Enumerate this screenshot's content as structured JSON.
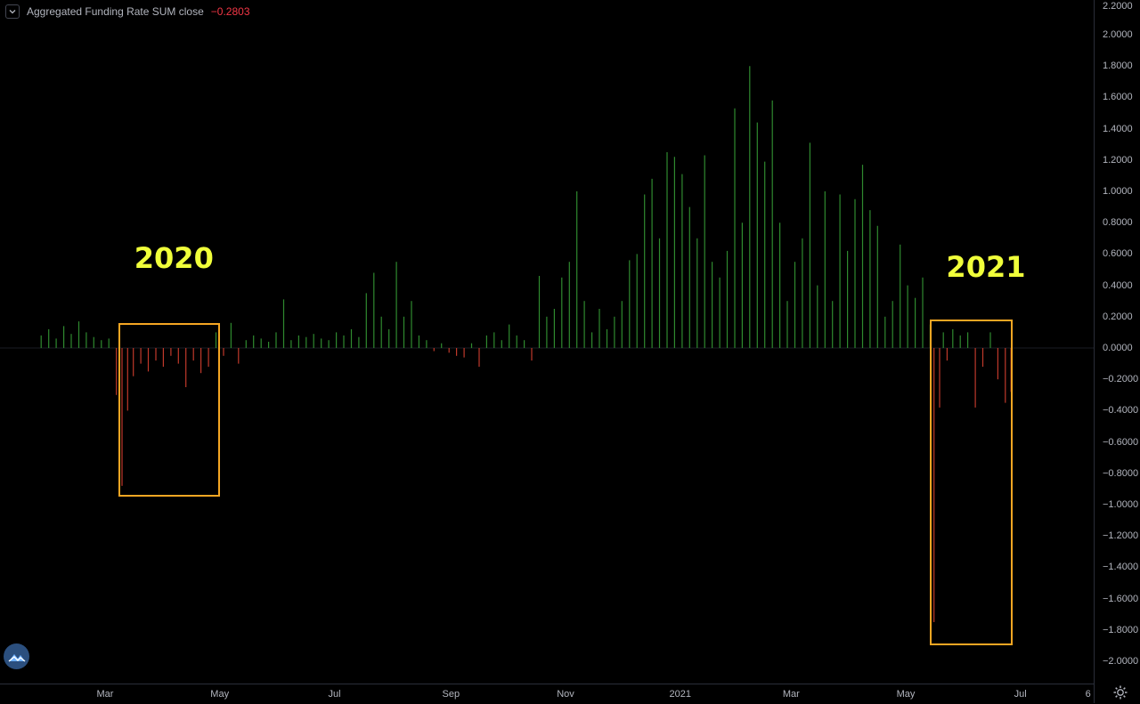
{
  "legend": {
    "title": "Aggregated Funding Rate SUM close",
    "value": "−0.2803",
    "value_color": "#f23645"
  },
  "annotations": [
    {
      "label": "2020",
      "from": "2020-03-08",
      "to": "2020-05-01",
      "top": 0.16,
      "bottom": -0.95
    },
    {
      "label": "2021",
      "from": "2021-05-14",
      "to": "2021-06-27",
      "top": 0.18,
      "bottom": -1.9
    }
  ],
  "colors": {
    "positive": "#2f8a2f",
    "negative": "#c0392b",
    "annotation_box": "#f5a623",
    "annotation_text": "#f0ff3a"
  },
  "icons": {
    "logo": "logo-icon",
    "settings": "gear-icon",
    "toggle": "chevron-down-icon"
  },
  "chart_data": {
    "type": "bar",
    "title": "Aggregated Funding Rate SUM close",
    "xlabel": "",
    "ylabel": "",
    "ylim": [
      -2.2,
      2.2
    ],
    "grid": false,
    "y_ticks": [
      "2.2000",
      "2.0000",
      "1.8000",
      "1.6000",
      "1.4000",
      "1.2000",
      "1.0000",
      "0.8000",
      "0.6000",
      "0.4000",
      "0.2000",
      "0.0000",
      "−0.2000",
      "−0.4000",
      "−0.6000",
      "−0.8000",
      "−1.0000",
      "−1.2000",
      "−1.4000",
      "−1.6000",
      "−1.8000",
      "−2.0000"
    ],
    "x_ticks": [
      {
        "label": "Mar",
        "date": "2020-03-01"
      },
      {
        "label": "May",
        "date": "2020-05-01"
      },
      {
        "label": "Jul",
        "date": "2020-07-01"
      },
      {
        "label": "Sep",
        "date": "2020-09-01"
      },
      {
        "label": "Nov",
        "date": "2020-11-01"
      },
      {
        "label": "2021",
        "date": "2021-01-01"
      },
      {
        "label": "Mar",
        "date": "2021-03-01"
      },
      {
        "label": "May",
        "date": "2021-05-01"
      },
      {
        "label": "Jul",
        "date": "2021-07-01"
      },
      {
        "label": "6",
        "date": "2021-08-06"
      }
    ],
    "x": [
      "2020-01-27",
      "2020-01-31",
      "2020-02-04",
      "2020-02-08",
      "2020-02-12",
      "2020-02-16",
      "2020-02-20",
      "2020-02-24",
      "2020-02-28",
      "2020-03-03",
      "2020-03-07",
      "2020-03-10",
      "2020-03-13",
      "2020-03-16",
      "2020-03-20",
      "2020-03-24",
      "2020-03-28",
      "2020-04-01",
      "2020-04-05",
      "2020-04-09",
      "2020-04-13",
      "2020-04-17",
      "2020-04-21",
      "2020-04-25",
      "2020-04-29",
      "2020-05-03",
      "2020-05-07",
      "2020-05-11",
      "2020-05-15",
      "2020-05-19",
      "2020-05-23",
      "2020-05-27",
      "2020-05-31",
      "2020-06-04",
      "2020-06-08",
      "2020-06-12",
      "2020-06-16",
      "2020-06-20",
      "2020-06-24",
      "2020-06-28",
      "2020-07-02",
      "2020-07-06",
      "2020-07-10",
      "2020-07-14",
      "2020-07-18",
      "2020-07-22",
      "2020-07-26",
      "2020-07-30",
      "2020-08-03",
      "2020-08-07",
      "2020-08-11",
      "2020-08-15",
      "2020-08-19",
      "2020-08-23",
      "2020-08-27",
      "2020-08-31",
      "2020-09-04",
      "2020-09-08",
      "2020-09-12",
      "2020-09-16",
      "2020-09-20",
      "2020-09-24",
      "2020-09-28",
      "2020-10-02",
      "2020-10-06",
      "2020-10-10",
      "2020-10-14",
      "2020-10-18",
      "2020-10-22",
      "2020-10-26",
      "2020-10-30",
      "2020-11-03",
      "2020-11-07",
      "2020-11-11",
      "2020-11-15",
      "2020-11-19",
      "2020-11-23",
      "2020-11-27",
      "2020-12-01",
      "2020-12-05",
      "2020-12-09",
      "2020-12-13",
      "2020-12-17",
      "2020-12-21",
      "2020-12-25",
      "2020-12-29",
      "2021-01-02",
      "2021-01-06",
      "2021-01-10",
      "2021-01-14",
      "2021-01-18",
      "2021-01-22",
      "2021-01-26",
      "2021-01-30",
      "2021-02-03",
      "2021-02-07",
      "2021-02-11",
      "2021-02-15",
      "2021-02-19",
      "2021-02-23",
      "2021-02-27",
      "2021-03-03",
      "2021-03-07",
      "2021-03-11",
      "2021-03-15",
      "2021-03-19",
      "2021-03-23",
      "2021-03-27",
      "2021-03-31",
      "2021-04-04",
      "2021-04-08",
      "2021-04-12",
      "2021-04-16",
      "2021-04-20",
      "2021-04-24",
      "2021-04-28",
      "2021-05-02",
      "2021-05-06",
      "2021-05-10",
      "2021-05-14",
      "2021-05-16",
      "2021-05-19",
      "2021-05-21",
      "2021-05-23",
      "2021-05-26",
      "2021-05-30",
      "2021-06-03",
      "2021-06-07",
      "2021-06-11",
      "2021-06-15",
      "2021-06-19",
      "2021-06-23",
      "2021-06-26"
    ],
    "values": [
      0.08,
      0.12,
      0.06,
      0.14,
      0.09,
      0.17,
      0.1,
      0.07,
      0.05,
      0.06,
      -0.3,
      -0.88,
      -0.4,
      -0.18,
      -0.1,
      -0.15,
      -0.08,
      -0.12,
      -0.05,
      -0.1,
      -0.25,
      -0.08,
      -0.16,
      -0.12,
      0.1,
      -0.05,
      0.16,
      -0.1,
      0.05,
      0.08,
      0.06,
      0.04,
      0.1,
      0.31,
      0.05,
      0.08,
      0.07,
      0.09,
      0.06,
      0.05,
      0.1,
      0.08,
      0.12,
      0.07,
      0.35,
      0.48,
      0.2,
      0.12,
      0.55,
      0.2,
      0.3,
      0.08,
      0.05,
      -0.02,
      0.03,
      -0.03,
      -0.05,
      -0.06,
      0.03,
      -0.12,
      0.08,
      0.1,
      0.05,
      0.15,
      0.08,
      0.05,
      -0.08,
      0.46,
      0.2,
      0.25,
      0.45,
      0.55,
      1.0,
      0.3,
      0.1,
      0.25,
      0.12,
      0.2,
      0.3,
      0.56,
      0.6,
      0.98,
      1.08,
      0.7,
      1.25,
      1.22,
      1.11,
      0.9,
      0.7,
      1.23,
      0.55,
      0.45,
      0.62,
      1.53,
      0.8,
      1.8,
      1.44,
      1.19,
      1.58,
      0.8,
      0.3,
      0.55,
      0.7,
      1.31,
      0.4,
      1.0,
      0.3,
      0.98,
      0.62,
      0.95,
      1.17,
      0.88,
      0.78,
      0.2,
      0.3,
      0.66,
      0.4,
      0.32,
      0.45,
      0.15,
      -1.75,
      -0.38,
      0.1,
      -0.08,
      0.12,
      0.08,
      0.1,
      -0.38,
      -0.12,
      0.1,
      -0.2,
      -0.35,
      -0.28
    ]
  }
}
